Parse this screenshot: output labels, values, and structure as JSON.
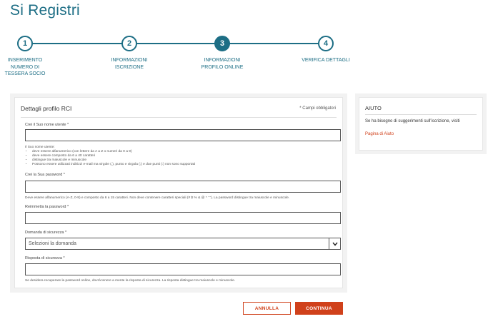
{
  "page": {
    "title": "Si Registri"
  },
  "stepper": {
    "steps": [
      {
        "number": "1",
        "label_lines": [
          "INSERIMENTO",
          "NUMERO DI",
          "TESSERA SOCIO"
        ]
      },
      {
        "number": "2",
        "label_lines": [
          "INFORMAZIONI",
          "ISCRIZIONE"
        ]
      },
      {
        "number": "3",
        "label_lines": [
          "INFORMAZIONI",
          "PROFILO ONLINE"
        ]
      },
      {
        "number": "4",
        "label_lines": [
          "VERIFICA DETTAGLI"
        ]
      }
    ],
    "active_step": "3"
  },
  "form": {
    "title": "Dettagli profilo RCI",
    "required_note": "* Campi obbligatori",
    "username": {
      "label": "Crei il Suo nome utente *",
      "value": "",
      "hint_intro": "Il Suo nome utente:",
      "hint_items": [
        "deve essere alfanumerico (con lettere da A a Z o numeri da 0 a 9)",
        "deve essere composto da 6 a 40 caratteri",
        "distingue tra maiuscole e minuscole",
        "Possono essere utilizzati indirizzi e-mail ma virgole (,), punto e virgola (;) e due punti (:) non sono supportati"
      ]
    },
    "password": {
      "label": "Crei la Sua password *",
      "value": "",
      "hint": "Deve essere alfanumerico (A-Z, 0-9) e composto da 6 a 15 caratteri. Non deve contenere caratteri speciali (# $ % & @ * ' \"). La password distingue tra maiuscole e minuscole."
    },
    "password_confirm": {
      "label": "Reimmetta la password *",
      "value": ""
    },
    "security_question": {
      "label": "Domanda di sicurezza *",
      "selected": "Selezioni la domanda"
    },
    "security_answer": {
      "label": "Risposta di sicurezza *",
      "value": "",
      "hint": "Se desidera recuperare la password online, dovrà tenere a mente la risposta di sicurezza. La risposta distingue tra maiuscole e minuscole."
    }
  },
  "help": {
    "title": "AIUTO",
    "text": "Se ha bisogno di suggerimenti sull'iscrizione, visiti",
    "link": "Pagina di Aiuto"
  },
  "actions": {
    "cancel_label": "ANNULLA",
    "continue_label": "CONTINUA"
  },
  "colors": {
    "primary": "#1d6e85",
    "accent": "#d0411b"
  }
}
